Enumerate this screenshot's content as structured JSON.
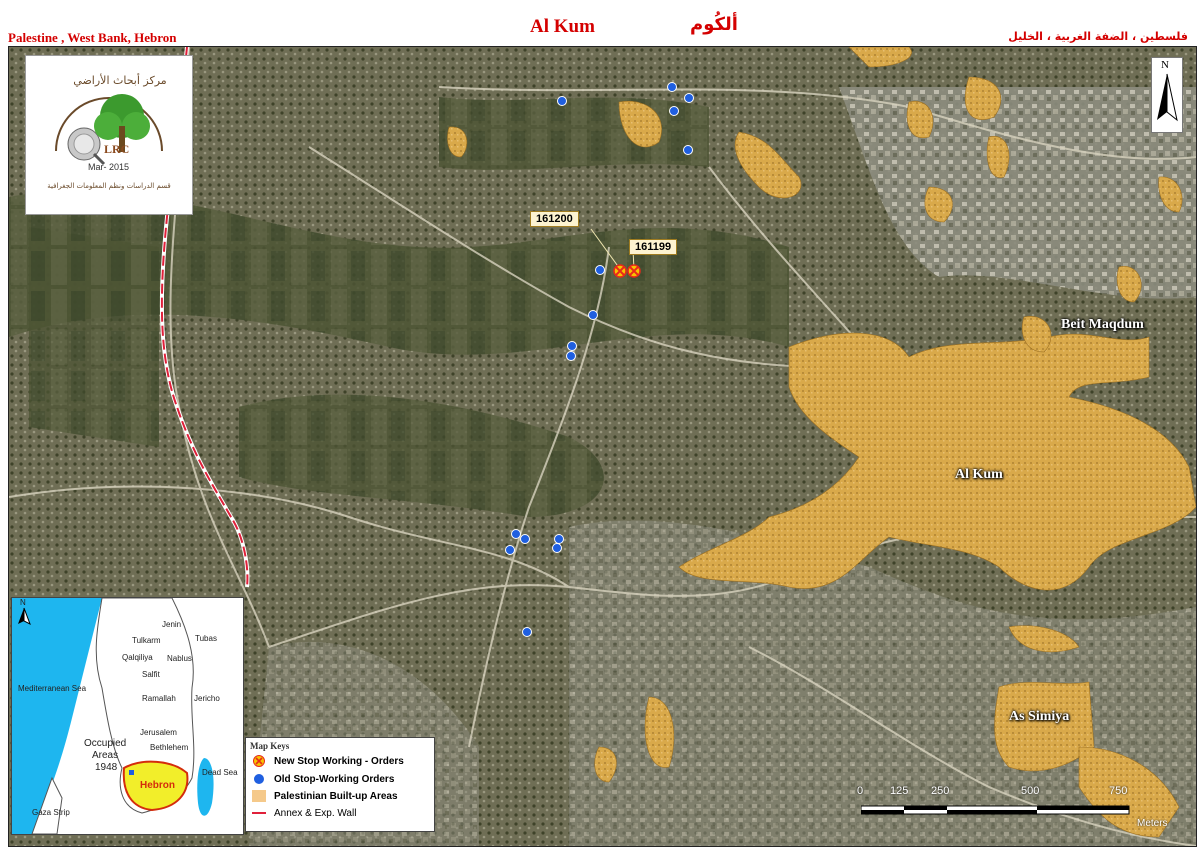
{
  "header": {
    "location_en": "Palestine , West Bank, Hebron",
    "title_en": "Al Kum",
    "title_ar": "ألكُوم",
    "location_ar": "فلسطين ، الضفة الغربية ، الخليل"
  },
  "logo": {
    "org_ar_top": "مركز أبحاث الأراضي",
    "org_ar_bottom": "قسم الدراسات ونظم المعلومات الجغرافية",
    "abbr": "LRC",
    "date": "Mar- 2015"
  },
  "north_arrow": {
    "label": "N"
  },
  "callouts": [
    {
      "id": "161200"
    },
    {
      "id": "161199"
    }
  ],
  "places": {
    "beit_maqdum": "Beit Maqdum",
    "al_kum": "Al Kum",
    "as_simiya": "As Simiya"
  },
  "inset": {
    "north": "N",
    "labels": {
      "jenin": "Jenin",
      "tubas": "Tubas",
      "tulkarm": "Tulkarm",
      "qalqiliya": "Qalqiliya",
      "nablus": "Nablus",
      "salfit": "Salfit",
      "ramallah": "Ramallah",
      "jericho": "Jericho",
      "jerusalem": "Jerusalem",
      "bethlehem": "Bethlehem",
      "hebron": "Hebron",
      "med_sea": "Mediterranean Sea",
      "occupied": "Occupied",
      "areas": "Areas",
      "year": "1948",
      "dead_sea": "Dead Sea",
      "gaza": "Gaza Strip"
    }
  },
  "legend": {
    "title": "Map Keys",
    "items": [
      {
        "label": "New Stop Working - Orders",
        "symbol": "red-x-circle"
      },
      {
        "label": "Old Stop-Working Orders",
        "symbol": "blue-dot"
      },
      {
        "label": "Palestinian Built-up Areas",
        "symbol": "tan-fill"
      },
      {
        "label": "Annex & Exp. Wall",
        "symbol": "red-line"
      }
    ]
  },
  "scale": {
    "ticks": [
      "0",
      "125",
      "250",
      "500",
      "750"
    ],
    "unit": "Meters"
  },
  "colors": {
    "title_red": "#d40000",
    "builtup": "#d9a94a",
    "old_order": "#1f5fe0",
    "new_order": "#e8291b",
    "wall": "#e0203a"
  }
}
